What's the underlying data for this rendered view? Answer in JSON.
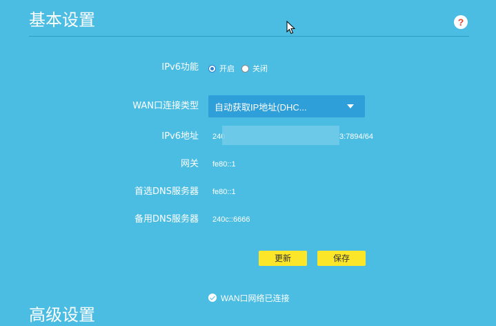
{
  "section": {
    "title": "基本设置",
    "help_symbol": "?"
  },
  "form": {
    "ipv6_function": {
      "label": "IPv6功能",
      "options": [
        {
          "label": "开启",
          "selected": true
        },
        {
          "label": "关闭",
          "selected": false
        }
      ]
    },
    "wan_type": {
      "label": "WAN口连接类型",
      "selected": "自动获取IP地址(DHC..."
    },
    "ipv6_address": {
      "label": "IPv6地址",
      "prefix": "240",
      "suffix": "3:7894/64"
    },
    "gateway": {
      "label": "网关",
      "value": "fe80::1"
    },
    "primary_dns": {
      "label": "首选DNS服务器",
      "value": "fe80::1"
    },
    "secondary_dns": {
      "label": "备用DNS服务器",
      "value": "240c::6666"
    }
  },
  "buttons": {
    "refresh": "更新",
    "save": "保存"
  },
  "status": {
    "text": "WAN口网络已连接"
  },
  "next_section": {
    "title": "高级设置"
  },
  "colors": {
    "background": "#4bbde2",
    "select_bg": "#2e9fd8",
    "button_bg": "#fbe62a",
    "help_icon": "#e8442e"
  }
}
